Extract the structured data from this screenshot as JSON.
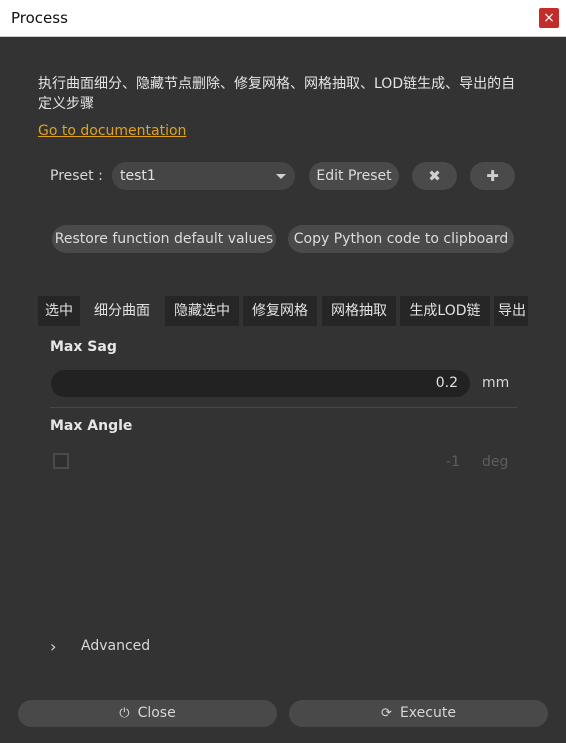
{
  "window": {
    "title": "Process",
    "close_glyph": "×"
  },
  "description": "执行曲面细分、隐藏节点删除、修复网格、网格抽取、LOD链生成、导出的自定义步骤",
  "doc_link": "Go to documentation",
  "preset": {
    "label": "Preset :",
    "selected": "test1",
    "edit_label": "Edit Preset",
    "delete_icon": "✖",
    "add_icon": "✚"
  },
  "actions": {
    "restore_label": "Restore function default values",
    "copy_label": "Copy Python code to clipboard"
  },
  "tabs": [
    "选中",
    "细分曲面",
    "隐藏选中",
    "修复网格",
    "网格抽取",
    "生成LOD链",
    "导出"
  ],
  "fields": {
    "max_sag": {
      "label": "Max Sag",
      "value": "0.2",
      "unit": "mm"
    },
    "max_angle": {
      "label": "Max Angle",
      "value": "-1",
      "unit": "deg",
      "enabled": false
    }
  },
  "advanced": {
    "chevron": "›",
    "label": "Advanced"
  },
  "footer": {
    "close_icon": "⏻",
    "close_label": "Close",
    "execute_icon": "⟳",
    "execute_label": "Execute"
  },
  "colors": {
    "background": "#333333",
    "link": "#e0a21f",
    "close_button": "#c42b2b"
  }
}
